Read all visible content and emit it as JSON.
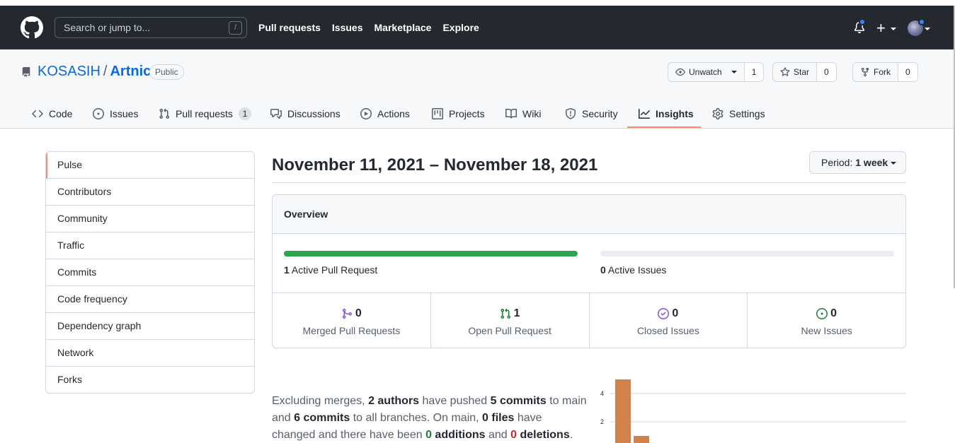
{
  "header": {
    "search_placeholder": "Search or jump to...",
    "search_shortcut": "/",
    "nav": [
      "Pull requests",
      "Issues",
      "Marketplace",
      "Explore"
    ],
    "plus_label": "+"
  },
  "repo": {
    "owner": "KOSASIH",
    "separator": "/",
    "name": "Artnic",
    "visibility": "Public",
    "unwatch_label": "Unwatch",
    "watch_count": "1",
    "star_label": "Star",
    "star_count": "0",
    "fork_label": "Fork",
    "fork_count": "0"
  },
  "tabs": [
    {
      "label": "Code",
      "icon": "code-icon"
    },
    {
      "label": "Issues",
      "icon": "issue-icon"
    },
    {
      "label": "Pull requests",
      "icon": "pull-request-icon",
      "count": "1"
    },
    {
      "label": "Discussions",
      "icon": "discussions-icon"
    },
    {
      "label": "Actions",
      "icon": "play-icon"
    },
    {
      "label": "Projects",
      "icon": "table-icon"
    },
    {
      "label": "Wiki",
      "icon": "book-icon"
    },
    {
      "label": "Security",
      "icon": "shield-icon"
    },
    {
      "label": "Insights",
      "icon": "graph-icon",
      "selected": true
    },
    {
      "label": "Settings",
      "icon": "gear-icon"
    }
  ],
  "sidebar": {
    "items": [
      "Pulse",
      "Contributors",
      "Community",
      "Traffic",
      "Commits",
      "Code frequency",
      "Dependency graph",
      "Network",
      "Forks"
    ],
    "active": "Pulse"
  },
  "pulse": {
    "date_range": "November 11, 2021 – November 18, 2021",
    "period_label": "Period:",
    "period_value": "1 week",
    "overview_title": "Overview",
    "active_pr_count": "1",
    "active_pr_label": "Active Pull Request",
    "active_pr_fill": 1.0,
    "active_issues_count": "0",
    "active_issues_label": "Active Issues",
    "active_issues_fill": 0.0,
    "stats": [
      {
        "value": "0",
        "label": "Merged Pull Requests",
        "icon": "git-merge-icon",
        "color": "#8250df"
      },
      {
        "value": "1",
        "label": "Open Pull Request",
        "icon": "git-pull-request-icon",
        "color": "#1a7f37"
      },
      {
        "value": "0",
        "label": "Closed Issues",
        "icon": "issue-closed-icon",
        "color": "#8250df"
      },
      {
        "value": "0",
        "label": "New Issues",
        "icon": "issue-opened-icon",
        "color": "#1a7f37"
      }
    ],
    "summary": {
      "t1": "Excluding merges, ",
      "authors": "2 authors",
      "t2": " have pushed ",
      "commits_main": "5 commits",
      "t3": " to main and ",
      "commits_all": "6 commits",
      "t4": " to all branches. On main, ",
      "files": "0 files",
      "t5": " have changed and there have been ",
      "additions_num": "0",
      "additions_word": " additions",
      "t6": " and ",
      "deletions_num": "0",
      "deletions_word": " deletions",
      "t7": "."
    }
  },
  "colors": {
    "header_bg": "#24292f",
    "accent_underline": "#fd8c73",
    "pr_bar": "#2da44e",
    "issues_bar": "#eaeef2",
    "chart_bar": "#d2814a"
  },
  "chart_data": {
    "type": "bar",
    "values": [
      5,
      1
    ],
    "y_ticks": [
      2,
      4
    ],
    "ylim": [
      0,
      5
    ]
  }
}
